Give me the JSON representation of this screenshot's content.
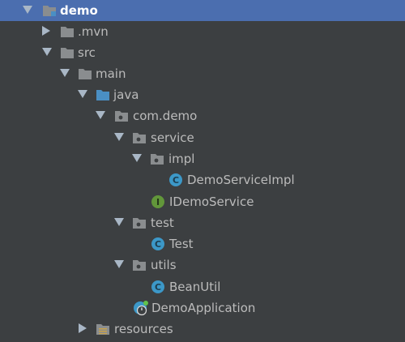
{
  "project_tree": {
    "colors": {
      "background": "#3c3f41",
      "selection": "#4b6eaf",
      "text": "#bbbbbb",
      "folder": "#8a8d8f",
      "source_folder": "#4a8fc4",
      "class_badge": "#3c98c8",
      "interface_badge": "#62973a"
    },
    "items": [
      {
        "label": "demo",
        "icon": "module-folder-icon",
        "expanded": true,
        "selected": true
      },
      {
        "label": ".mvn",
        "icon": "folder-icon",
        "expanded": false
      },
      {
        "label": "src",
        "icon": "folder-icon",
        "expanded": true
      },
      {
        "label": "main",
        "icon": "folder-icon",
        "expanded": true
      },
      {
        "label": "java",
        "icon": "source-folder-icon",
        "expanded": true
      },
      {
        "label": "com.demo",
        "icon": "package-icon",
        "expanded": true
      },
      {
        "label": "service",
        "icon": "package-icon",
        "expanded": true
      },
      {
        "label": "impl",
        "icon": "package-icon",
        "expanded": true
      },
      {
        "label": "DemoServiceImpl",
        "icon": "class-icon",
        "badge": "C"
      },
      {
        "label": "IDemoService",
        "icon": "interface-icon",
        "badge": "I"
      },
      {
        "label": "test",
        "icon": "package-icon",
        "expanded": true
      },
      {
        "label": "Test",
        "icon": "class-icon",
        "badge": "C"
      },
      {
        "label": "utils",
        "icon": "package-icon",
        "expanded": true
      },
      {
        "label": "BeanUtil",
        "icon": "class-icon",
        "badge": "C"
      },
      {
        "label": "DemoApplication",
        "icon": "spring-boot-class-icon"
      },
      {
        "label": "resources",
        "icon": "resources-folder-icon",
        "expanded": false
      }
    ]
  }
}
